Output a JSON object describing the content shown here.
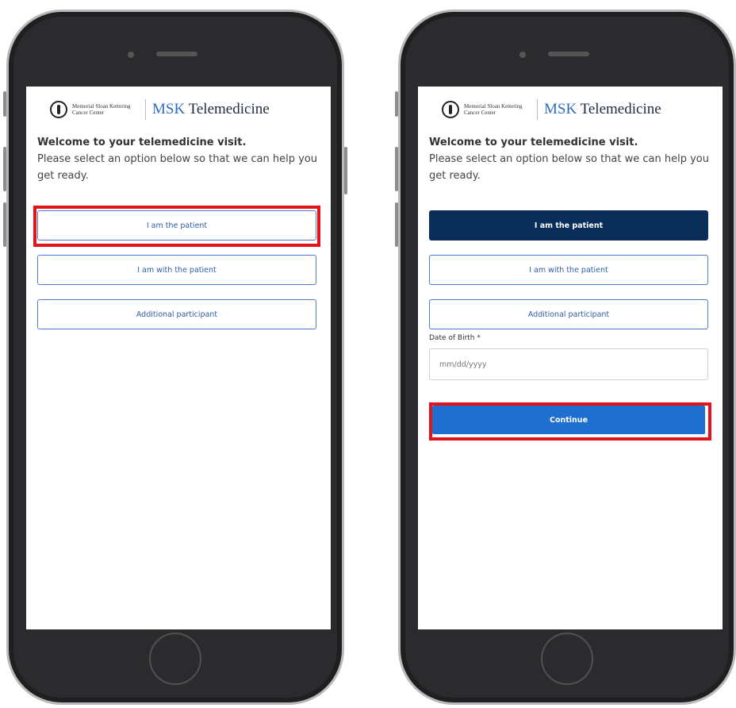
{
  "screens": [
    {
      "id": "left",
      "org_name": "Memorial Sloan Kettering Cancer Center",
      "brand_prefix": "MSK",
      "brand_rest": " Telemedicine",
      "headline": "Welcome to your telemedicine visit.",
      "subtext": "Please select an option below so that we can help you get ready.",
      "options": [
        "I am the patient",
        "I am with the patient",
        "Additional participant"
      ],
      "selected_option_index": null,
      "highlighted_element": "I am the patient"
    },
    {
      "id": "right",
      "org_name": "Memorial Sloan Kettering Cancer Center",
      "brand_prefix": "MSK",
      "brand_rest": " Telemedicine",
      "headline": "Welcome to your telemedicine visit.",
      "subtext": "Please select an option below so that we can help you get ready.",
      "options": [
        "I am the patient",
        "I am with the patient",
        "Additional participant"
      ],
      "selected_option_index": 0,
      "dob_label": "Date of Birth *",
      "dob_placeholder": "mm/dd/yyyy",
      "continue_label": "Continue",
      "highlighted_element": "Continue"
    }
  ],
  "colors": {
    "selected_button": "#0b2d5a",
    "continue_button": "#1e6fd0",
    "highlight": "#e3131b",
    "link_blue": "#2f5ea8"
  }
}
